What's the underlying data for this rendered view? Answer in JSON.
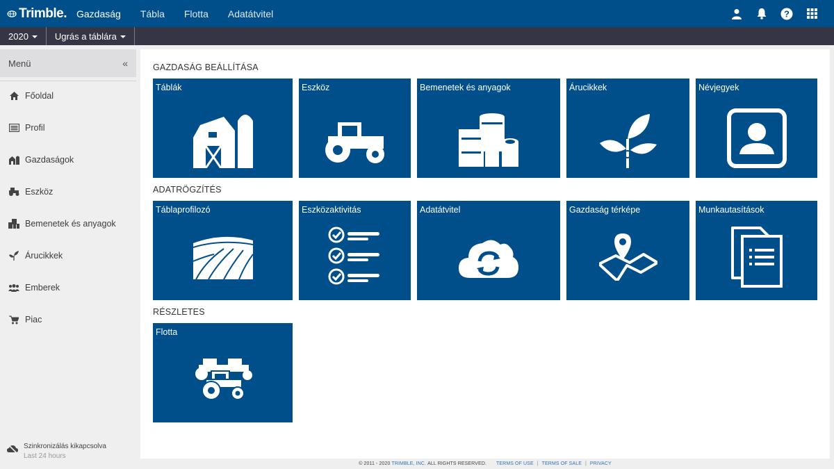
{
  "topnav": {
    "brand": "Trimble.",
    "links": [
      {
        "label": "Gazdaság",
        "active": true
      },
      {
        "label": "Tábla",
        "active": false
      },
      {
        "label": "Flotta",
        "active": false
      },
      {
        "label": "Adatátvitel",
        "active": false
      }
    ],
    "icons": [
      "user-icon",
      "bell-icon",
      "help-icon",
      "apps-grid-icon"
    ]
  },
  "subnav": {
    "year": "2020",
    "jump": "Ugrás a táblára"
  },
  "sidebar": {
    "menu_label": "Menü",
    "collapse_label": "«",
    "items": [
      {
        "label": "Főoldal",
        "icon": "home-icon"
      },
      {
        "label": "Profil",
        "icon": "profile-card-icon"
      },
      {
        "label": "Gazdaságok",
        "icon": "farm-icon"
      },
      {
        "label": "Eszköz",
        "icon": "tractor-icon"
      },
      {
        "label": "Bemenetek és anyagok",
        "icon": "inputs-icon"
      },
      {
        "label": "Árucikkek",
        "icon": "plant-icon"
      },
      {
        "label": "Emberek",
        "icon": "people-icon"
      },
      {
        "label": "Piac",
        "icon": "cart-icon"
      }
    ],
    "sync": {
      "line1": "Szinkronizálás kikapcsolva",
      "line2": "Last 24 hours"
    }
  },
  "sections": {
    "setup": {
      "title": "GAZDASÁG BEÁLLÍTÁSA",
      "tiles": [
        "Táblák",
        "Eszköz",
        "Bemenetek és anyagok",
        "Árucikkek",
        "Névjegyek"
      ]
    },
    "data": {
      "title": "ADATRÖGZÍTÉS",
      "tiles": [
        "Táblaprofilozó",
        "Eszközaktivitás",
        "Adatátvitel",
        "Gazdaság térképe",
        "Munkautasítások"
      ]
    },
    "details": {
      "title": "RÉSZLETES",
      "tiles": [
        "Flotta"
      ]
    }
  },
  "footer": {
    "copyright": "© 2011 - 2020",
    "company": "TRIMBLE, INC.",
    "rights": "ALL RIGHTS RESERVED.",
    "terms_use": "TERMS OF USE",
    "terms_sale": "TERMS OF SALE",
    "privacy": "PRIVACY"
  },
  "colors": {
    "brand_blue": "#004f8b",
    "subnav": "#363545",
    "sidebar": "#efeff0"
  }
}
